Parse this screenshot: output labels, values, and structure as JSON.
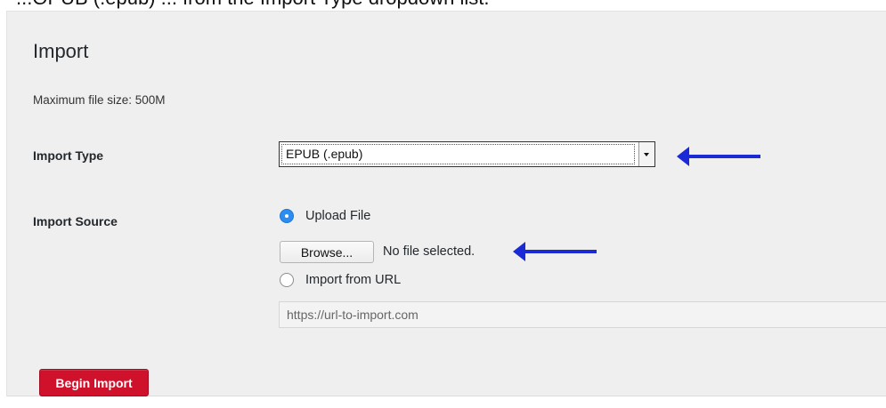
{
  "top_cropped_text": "...OPUB (.epub) ... from the Import Type dropdown list.",
  "page": {
    "title": "Import",
    "max_file_size": "Maximum file size: 500M"
  },
  "form": {
    "import_type": {
      "label": "Import Type",
      "selected": "EPUB (.epub)"
    },
    "import_source": {
      "label": "Import Source",
      "options": [
        {
          "label": "Upload File",
          "checked": true
        },
        {
          "label": "Import from URL",
          "checked": false
        }
      ],
      "browse_label": "Browse...",
      "file_status": "No file selected.",
      "url_placeholder": "https://url-to-import.com"
    },
    "submit_label": "Begin Import"
  },
  "annotations": {
    "arrow_color": "#1a2bd6"
  },
  "colors": {
    "primary_button": "#d0112b",
    "radio_checked": "#2d8cf0",
    "panel_background": "#efefef"
  }
}
